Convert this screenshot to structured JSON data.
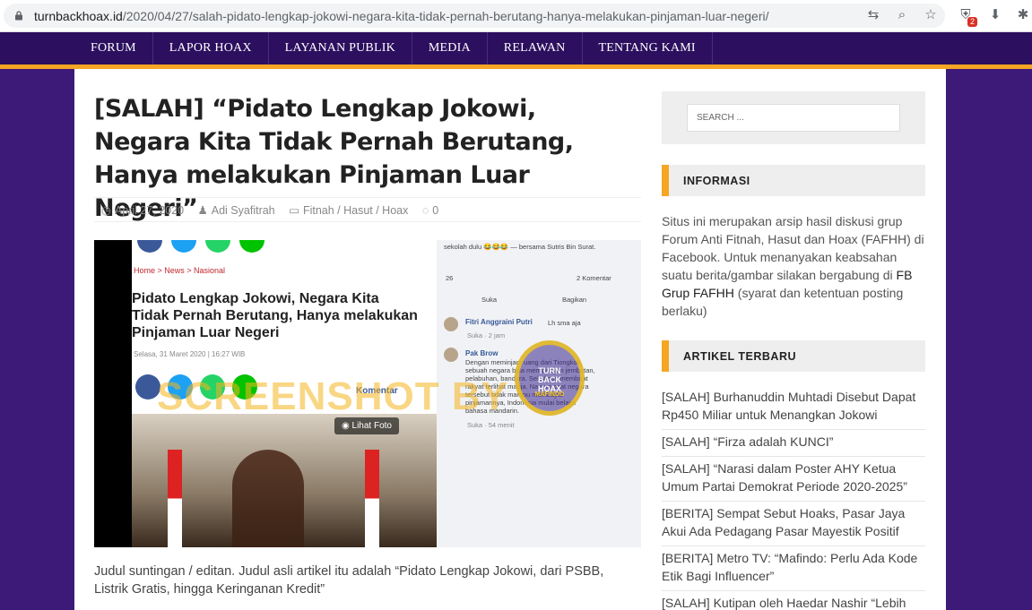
{
  "browser": {
    "url_domain": "turnbackhoax.id",
    "url_path": "/2020/04/27/salah-pidato-lengkap-jokowi-negara-kita-tidak-pernah-berutang-hanya-melakukan-pinjaman-luar-negeri/",
    "ext_badge": "2"
  },
  "nav": {
    "items": [
      "FORUM",
      "LAPOR HOAX",
      "LAYANAN PUBLIK",
      "MEDIA",
      "RELAWAN",
      "TENTANG KAMI"
    ]
  },
  "article": {
    "title": "[SALAH] “Pidato Lengkap Jokowi, Negara Kita Tidak Pernah Berutang, Hanya melakukan Pinjaman Luar Negeri”",
    "date": "April 27, 2020",
    "author": "Adi Syafitrah",
    "categories": "Fitnah / Hasut / Hoax",
    "comments": "0",
    "caption": "Judul suntingan / editan. Judul asli artikel itu adalah “Pidato Lengkap Jokowi, dari PSBB, Listrik Gratis, hingga Keringanan Kredit”"
  },
  "screenshot": {
    "breadcrumb": "Home  >  News  >  Nasional",
    "headline": "Pidato Lengkap Jokowi, Negara Kita Tidak Pernah Berutang, Hanya melakukan Pinjaman Luar Negeri",
    "dateline": "Selasa, 31 Maret 2020 | 16:27 WIB",
    "komentar": "Komentar",
    "lihat_foto": "Lihat Foto",
    "watermark": "SCREENSHOT BY",
    "fb_top": "sekolah dulu 😂😂😂 — bersama Sutris Bin Surat.",
    "fb_reactions": "26",
    "fb_komentar": "2 Komentar",
    "fb_suka": "Suka",
    "fb_bagikan": "Bagikan",
    "c1_name": "Fitri Anggraini Putri",
    "c1_text": "Lh sma aja",
    "c1_meta": "Suka · 2 jam",
    "c2_name": "Pak Brow",
    "c2_text": "Dengan meminjam uang dari Tiongkok, sebuah negara bisa membangun jembatan, pelabuhan, bandara. Sekaligus membuat rakyat terlihat manja. Namun saat negara tersebut tidak mampu membayar pinjamannya, Indonesia mulai belajar bahasa mandarin.",
    "c2_meta": "Suka · 54 menit",
    "seal_text": "TURN BACK HOAX",
    "seal_sub": "MAFINDO"
  },
  "sidebar": {
    "search_placeholder": "SEARCH ...",
    "info_heading": "INFORMASI",
    "info_text_1": "Situs ini merupakan arsip hasil diskusi grup Forum Anti Fitnah, Hasut dan Hoax (FAFHH) di Facebook. Untuk menanyakan keabsahan suatu berita/gambar silakan bergabung di ",
    "info_link": "FB Grup FAFHH",
    "info_text_2": " (syarat dan ketentuan posting berlaku)",
    "recent_heading": "ARTIKEL TERBARU",
    "recent": [
      "[SALAH] Burhanuddin Muhtadi Disebut Dapat Rp450 Miliar untuk Menangkan Jokowi",
      "[SALAH] “Firza adalah KUNCI”",
      "[SALAH] “Narasi dalam Poster AHY Ketua Umum Partai Demokrat Periode 2020-2025”",
      "[BERITA] Sempat Sebut Hoaks, Pasar Jaya Akui Ada Pedagang Pasar Mayestik Positif",
      "[BERITA] Metro TV: “Mafindo: Perlu Ada Kode Etik Bagi Influencer”",
      "[SALAH] Kutipan oleh Haedar Nashir “Lebih"
    ]
  }
}
